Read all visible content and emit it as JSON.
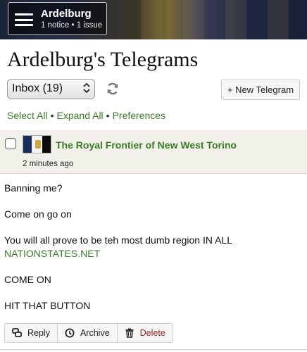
{
  "menu": {
    "title": "Ardelburg",
    "subtitle": "1 notice • 1 issue"
  },
  "page": {
    "title": "Ardelburg's Telegrams"
  },
  "toolbar": {
    "folder_selected": "Inbox (19)",
    "new_button": "+ New Telegram"
  },
  "links": {
    "select_all": "Select All",
    "expand_all": "Expand All",
    "preferences": "Preferences",
    "separator": "•"
  },
  "telegram": {
    "sender": "The Royal Frontier of New West Torino",
    "time": "2 minutes ago",
    "body": {
      "line1": "Banning me?",
      "line2": "Come on go on",
      "line3": "You will all prove to be teh most dumb region IN ALL",
      "line3_link": "NATIONSTATES.NET",
      "line4": "COME ON",
      "line5": "HIT THAT BUTTON"
    },
    "actions": {
      "reply": "Reply",
      "archive": "Archive",
      "delete": "Delete"
    }
  },
  "colors": {
    "link_green": "#3a7b26",
    "delete_red": "#9a2121",
    "header_bg": "#f1f1ea"
  },
  "icons": [
    "hamburger-icon",
    "refresh-icon",
    "chevron-updown-icon",
    "reply-icon",
    "archive-icon",
    "trash-icon"
  ]
}
